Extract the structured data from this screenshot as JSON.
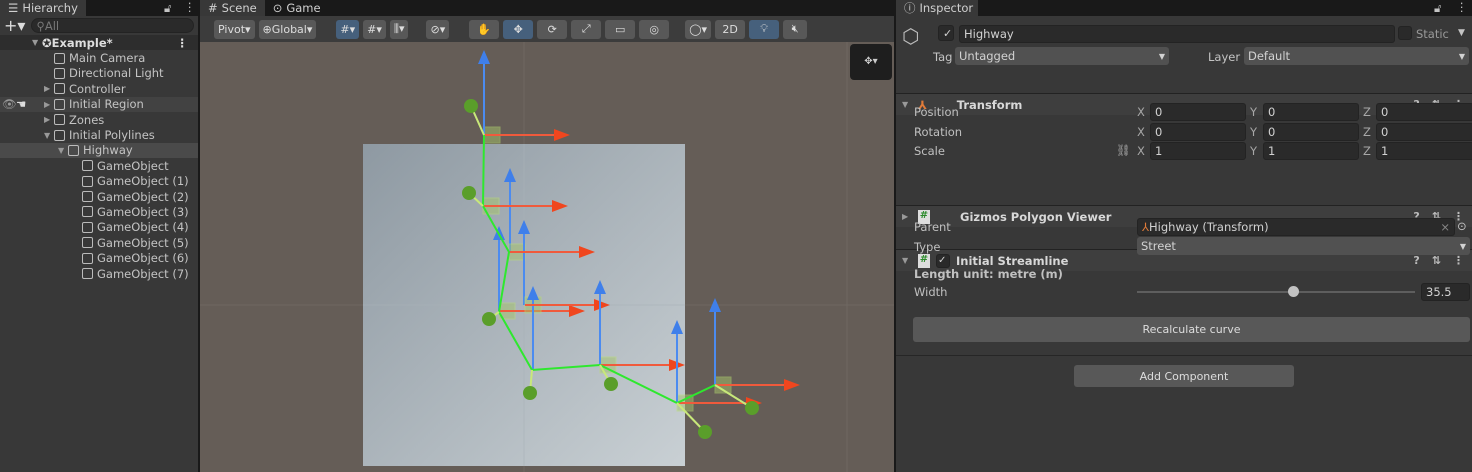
{
  "hierarchy": {
    "title": "Hierarchy",
    "search_placeholder": "All",
    "scene": "Example*",
    "items": [
      {
        "label": "Main Camera",
        "depth": 1,
        "arrow": ""
      },
      {
        "label": "Directional Light",
        "depth": 1,
        "arrow": ""
      },
      {
        "label": "Controller",
        "depth": 1,
        "arrow": "▶"
      },
      {
        "label": "Initial Region",
        "depth": 1,
        "arrow": "▶"
      },
      {
        "label": "Zones",
        "depth": 1,
        "arrow": "▶"
      },
      {
        "label": "Initial Polylines",
        "depth": 1,
        "arrow": "▼"
      },
      {
        "label": "Highway",
        "depth": 2,
        "arrow": "▼",
        "selected": true
      },
      {
        "label": "GameObject",
        "depth": 3,
        "arrow": ""
      },
      {
        "label": "GameObject (1)",
        "depth": 3,
        "arrow": ""
      },
      {
        "label": "GameObject (2)",
        "depth": 3,
        "arrow": ""
      },
      {
        "label": "GameObject (3)",
        "depth": 3,
        "arrow": ""
      },
      {
        "label": "GameObject (4)",
        "depth": 3,
        "arrow": ""
      },
      {
        "label": "GameObject (5)",
        "depth": 3,
        "arrow": ""
      },
      {
        "label": "GameObject (6)",
        "depth": 3,
        "arrow": ""
      },
      {
        "label": "GameObject (7)",
        "depth": 3,
        "arrow": ""
      }
    ]
  },
  "scene": {
    "tabs": [
      "Scene",
      "Game"
    ],
    "pivot": "Pivot",
    "global": "Global",
    "two_d": "2D"
  },
  "inspector": {
    "title": "Inspector",
    "name": "Highway",
    "static": "Static",
    "tag_label": "Tag",
    "tag": "Untagged",
    "layer_label": "Layer",
    "layer": "Default",
    "transform": {
      "title": "Transform",
      "position_label": "Position",
      "rotation_label": "Rotation",
      "scale_label": "Scale",
      "position": [
        "0",
        "0",
        "0"
      ],
      "rotation": [
        "0",
        "0",
        "0"
      ],
      "scale": [
        "1",
        "1",
        "1"
      ],
      "axes": [
        "X",
        "Y",
        "Z"
      ]
    },
    "gizmos": {
      "title": "Gizmos Polygon Viewer"
    },
    "streamline": {
      "title": "Initial Streamline",
      "parent_label": "Parent",
      "parent": "Highway (Transform)",
      "type_label": "Type",
      "type": "Street",
      "unit_label": "Length unit: metre (m)",
      "width_label": "Width",
      "width": "35.5",
      "width_slider_fraction": 0.56,
      "recalc": "Recalculate curve"
    },
    "add_component": "Add Component"
  }
}
